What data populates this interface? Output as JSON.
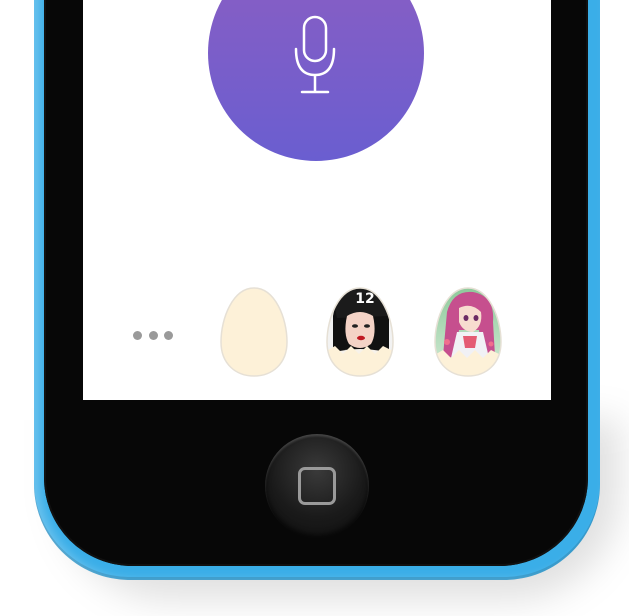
{
  "device": {
    "frame_color": "#3aaee8",
    "bezel_color": "#070707"
  },
  "screen": {
    "background": "#ffffff",
    "mic_button": {
      "icon": "microphone-icon",
      "gradient_top": "#8c5ec2",
      "gradient_bottom": "#6a5ed0"
    },
    "contacts_row": {
      "more_icon": "more-dots-icon",
      "eggs": [
        {
          "icon": "empty-egg-avatar",
          "fill": "#fdf1d8"
        },
        {
          "icon": "egg-avatar-girl-cap",
          "label": "12"
        },
        {
          "icon": "egg-avatar-anime-girl"
        }
      ]
    }
  },
  "home_button": {
    "icon": "home-square-icon"
  }
}
